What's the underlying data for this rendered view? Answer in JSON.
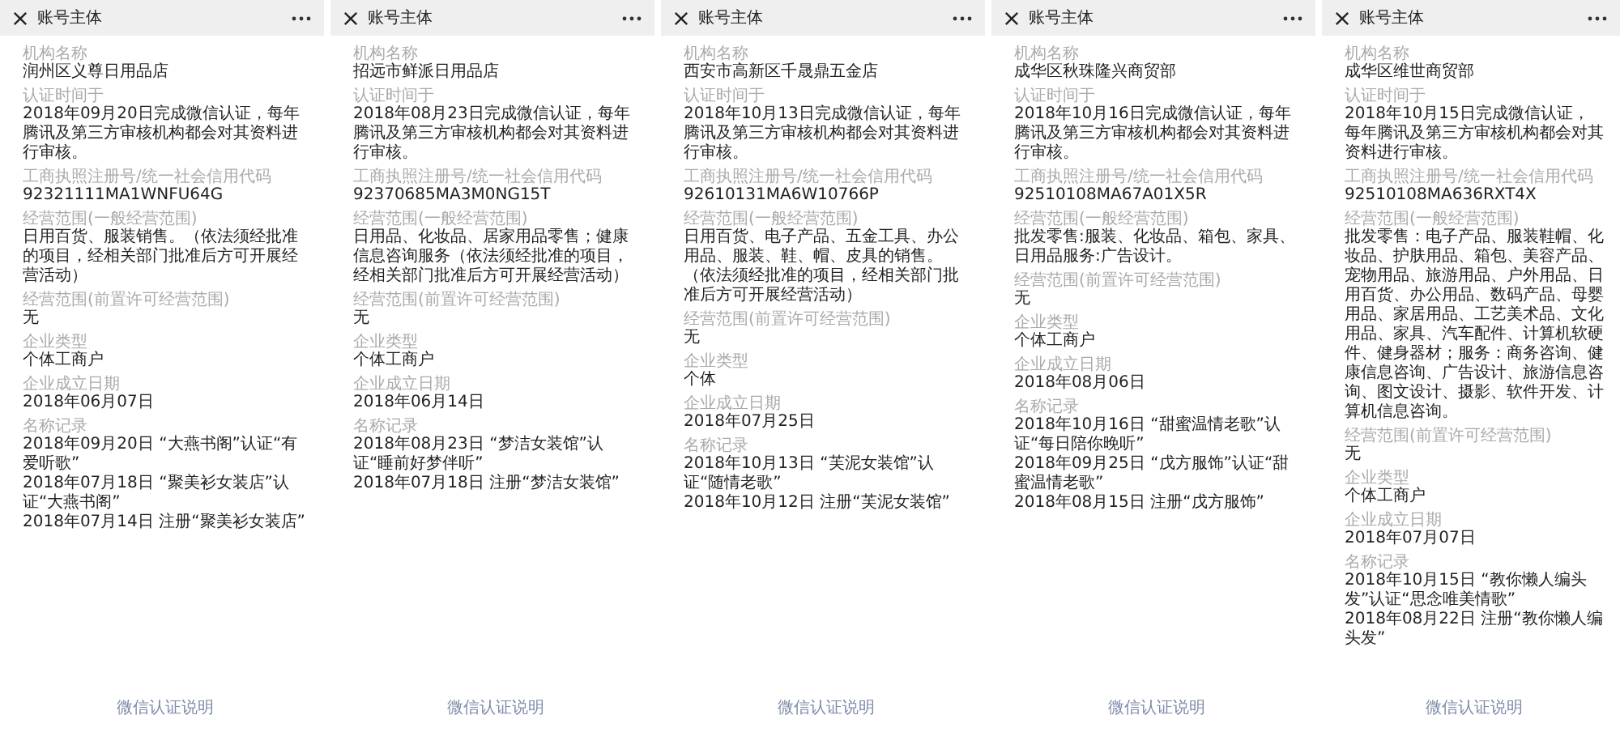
{
  "panels": [
    {
      "title": "账号主体",
      "fields": [
        {
          "label": "机构名称",
          "lines": [
            "润州区义尊日用品店"
          ]
        },
        {
          "label": "认证时间于",
          "lines": [
            "2018年09月20日完成微信认证，每年腾讯及第三方审核机构都会对其资料进行审核。"
          ]
        },
        {
          "label": "工商执照注册号/统一社会信用代码",
          "lines": [
            "92321111MA1WNFU64G"
          ]
        },
        {
          "label": "经营范围(一般经营范围)",
          "lines": [
            "日用百货、服装销售。（依法须经批准的项目，经相关部门批准后方可开展经营活动）"
          ]
        },
        {
          "label": "经营范围(前置许可经营范围)",
          "lines": [
            "无"
          ]
        },
        {
          "label": "企业类型",
          "lines": [
            "个体工商户"
          ]
        },
        {
          "label": "企业成立日期",
          "lines": [
            "2018年06月07日"
          ]
        },
        {
          "label": "名称记录",
          "lines": [
            "2018年09月20日 “大燕书阁”认证“有爱听歌”",
            "2018年07月18日 “聚美衫女装店”认证“大燕书阁”",
            "2018年07月14日 注册“聚美衫女装店”"
          ]
        }
      ],
      "footer_link": "微信认证说明"
    },
    {
      "title": "账号主体",
      "fields": [
        {
          "label": "机构名称",
          "lines": [
            "招远市鲜派日用品店"
          ]
        },
        {
          "label": "认证时间于",
          "lines": [
            "2018年08月23日完成微信认证，每年腾讯及第三方审核机构都会对其资料进行审核。"
          ]
        },
        {
          "label": "工商执照注册号/统一社会信用代码",
          "lines": [
            "92370685MA3M0NG15T"
          ]
        },
        {
          "label": "经营范围(一般经营范围)",
          "lines": [
            "日用品、化妆品、居家用品零售；健康信息咨询服务（依法须经批准的项目，经相关部门批准后方可开展经营活动）"
          ]
        },
        {
          "label": "经营范围(前置许可经营范围)",
          "lines": [
            "无"
          ]
        },
        {
          "label": "企业类型",
          "lines": [
            "个体工商户"
          ]
        },
        {
          "label": "企业成立日期",
          "lines": [
            "2018年06月14日"
          ]
        },
        {
          "label": "名称记录",
          "lines": [
            "2018年08月23日 “梦洁女装馆”认证“睡前好梦伴听”",
            "2018年07月18日 注册“梦洁女装馆”"
          ]
        }
      ],
      "footer_link": "微信认证说明"
    },
    {
      "title": "账号主体",
      "fields": [
        {
          "label": "机构名称",
          "lines": [
            "西安市高新区千晟鼎五金店"
          ]
        },
        {
          "label": "认证时间于",
          "lines": [
            "2018年10月13日完成微信认证，每年腾讯及第三方审核机构都会对其资料进行审核。"
          ]
        },
        {
          "label": "工商执照注册号/统一社会信用代码",
          "lines": [
            "92610131MA6W10766P"
          ]
        },
        {
          "label": "经营范围(一般经营范围)",
          "lines": [
            "日用百货、电子产品、五金工具、办公用品、服装、鞋、帽、皮具的销售。（依法须经批准的项目，经相关部门批准后方可开展经营活动）"
          ]
        },
        {
          "label": "经营范围(前置许可经营范围)",
          "lines": [
            "无"
          ]
        },
        {
          "label": "企业类型",
          "lines": [
            "个体"
          ]
        },
        {
          "label": "企业成立日期",
          "lines": [
            "2018年07月25日"
          ]
        },
        {
          "label": "名称记录",
          "lines": [
            "2018年10月13日 “芙泥女装馆”认证“随情老歌”",
            "2018年10月12日 注册“芙泥女装馆”"
          ]
        }
      ],
      "footer_link": "微信认证说明"
    },
    {
      "title": "账号主体",
      "fields": [
        {
          "label": "机构名称",
          "lines": [
            "成华区秋珠隆兴商贸部"
          ]
        },
        {
          "label": "认证时间于",
          "lines": [
            "2018年10月16日完成微信认证，每年腾讯及第三方审核机构都会对其资料进行审核。"
          ]
        },
        {
          "label": "工商执照注册号/统一社会信用代码",
          "lines": [
            "92510108MA67A01X5R"
          ]
        },
        {
          "label": "经营范围(一般经营范围)",
          "lines": [
            "批发零售:服装、化妆品、箱包、家具、日用品服务:广告设计。"
          ]
        },
        {
          "label": "经营范围(前置许可经营范围)",
          "lines": [
            "无"
          ]
        },
        {
          "label": "企业类型",
          "lines": [
            "个体工商户"
          ]
        },
        {
          "label": "企业成立日期",
          "lines": [
            "2018年08月06日"
          ]
        },
        {
          "label": "名称记录",
          "lines": [
            "2018年10月16日 “甜蜜温情老歌”认证“每日陪你晚听”",
            "2018年09月25日 “戊方服饰”认证“甜蜜温情老歌”",
            "2018年08月15日 注册“戊方服饰”"
          ]
        }
      ],
      "footer_link": "微信认证说明"
    },
    {
      "title": "账号主体",
      "fields": [
        {
          "label": "机构名称",
          "lines": [
            "成华区维世商贸部"
          ]
        },
        {
          "label": "认证时间于",
          "lines": [
            "2018年10月15日完成微信认证，每年腾讯及第三方审核机构都会对其资料进行审核。"
          ]
        },
        {
          "label": "工商执照注册号/统一社会信用代码",
          "lines": [
            "92510108MA636RXT4X"
          ]
        },
        {
          "label": "经营范围(一般经营范围)",
          "lines": [
            "批发零售：电子产品、服装鞋帽、化妆品、护肤用品、箱包、美容产品、宠物用品、旅游用品、户外用品、日用百货、办公用品、数码产品、母婴用品、家居用品、工艺美术品、文化用品、家具、汽车配件、计算机软硬件、健身器材；服务：商务咨询、健康信息咨询、广告设计、旅游信息咨询、图文设计、摄影、软件开发、计算机信息咨询。"
          ]
        },
        {
          "label": "经营范围(前置许可经营范围)",
          "lines": [
            "无"
          ]
        },
        {
          "label": "企业类型",
          "lines": [
            "个体工商户"
          ]
        },
        {
          "label": "企业成立日期",
          "lines": [
            "2018年07月07日"
          ]
        },
        {
          "label": "名称记录",
          "lines": [
            "2018年10月15日 “教你懒人编头发”认证“思念唯美情歌”",
            "2018年08月22日 注册“教你懒人编头发”"
          ]
        }
      ],
      "footer_link": "微信认证说明"
    }
  ]
}
